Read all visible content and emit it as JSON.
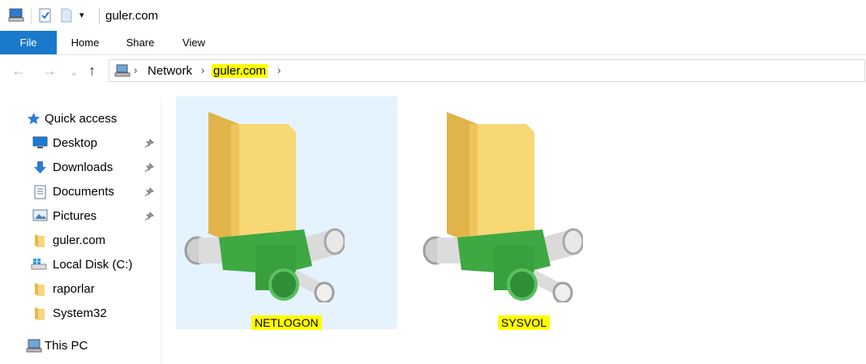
{
  "window": {
    "title": "guler.com"
  },
  "ribbon": {
    "tabs": [
      "File",
      "Home",
      "Share",
      "View"
    ]
  },
  "address": {
    "breadcrumbs": [
      "Network",
      "guler.com"
    ]
  },
  "sidebar": {
    "quick_access": "Quick access",
    "items": [
      {
        "label": "Desktop",
        "icon": "desktop-icon",
        "pinned": true
      },
      {
        "label": "Downloads",
        "icon": "download-icon",
        "pinned": true
      },
      {
        "label": "Documents",
        "icon": "documents-icon",
        "pinned": true
      },
      {
        "label": "Pictures",
        "icon": "pictures-icon",
        "pinned": true
      },
      {
        "label": "guler.com",
        "icon": "folder-icon",
        "pinned": false
      },
      {
        "label": "Local Disk (C:)",
        "icon": "disk-icon",
        "pinned": false
      },
      {
        "label": "raporlar",
        "icon": "folder-icon",
        "pinned": false
      },
      {
        "label": "System32",
        "icon": "folder-icon",
        "pinned": false
      }
    ],
    "this_pc": "This PC"
  },
  "content": {
    "items": [
      {
        "name": "NETLOGON",
        "selected": true
      },
      {
        "name": "SYSVOL",
        "selected": false
      }
    ]
  },
  "colors": {
    "accent": "#1979ca",
    "selection": "#e5f3ff",
    "highlight": "#ffff00"
  }
}
